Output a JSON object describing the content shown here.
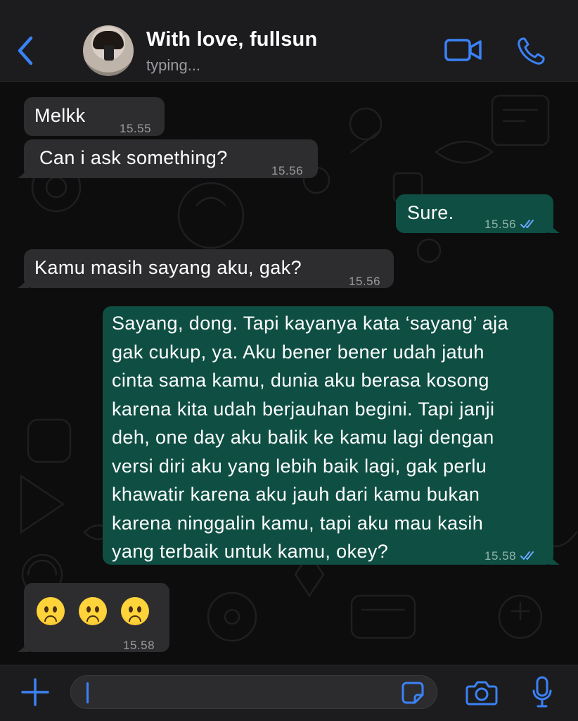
{
  "header": {
    "contact_name": "With love, fullsun",
    "status": "typing...",
    "back_icon": "chevron-left-icon",
    "video_icon": "video-camera-icon",
    "call_icon": "phone-icon"
  },
  "messages": [
    {
      "direction": "incoming",
      "text": "Melkk",
      "time": "15.55"
    },
    {
      "direction": "incoming",
      "text": "Can i ask something?",
      "time": "15.56"
    },
    {
      "direction": "outgoing",
      "text": "Sure.",
      "time": "15.56",
      "status": "read"
    },
    {
      "direction": "incoming",
      "text": "Kamu masih sayang aku, gak?",
      "time": "15.56"
    },
    {
      "direction": "outgoing",
      "lines": [
        "Sayang, dong. Tapi kayanya kata ‘sayang’ aja",
        "gak cukup, ya. Aku bener bener udah jatuh",
        "cinta sama kamu, dunia aku berasa kosong",
        "karena kita udah berjauhan begini. Tapi janji",
        "deh, one day aku balik ke kamu lagi dengan",
        "versi diri aku yang lebih baik lagi, gak perlu",
        "khawatir karena aku jauh dari kamu bukan",
        "karena ninggalin kamu, tapi aku mau kasih",
        "yang terbaik untuk kamu, okey?"
      ],
      "time": "15.58",
      "status": "read"
    },
    {
      "direction": "incoming",
      "emojis": [
        "frowning-face",
        "frowning-face",
        "frowning-face"
      ],
      "time": "15.58"
    }
  ],
  "input_bar": {
    "plus_icon": "plus-icon",
    "input_value": "",
    "sticker_icon": "sticker-icon",
    "camera_icon": "camera-icon",
    "mic_icon": "microphone-icon"
  },
  "colors": {
    "accent": "#3b82f6",
    "incoming_bubble": "#2d2d30",
    "outgoing_bubble": "#0f4f43",
    "background": "#0d0d0d",
    "header": "#1c1c1e"
  }
}
